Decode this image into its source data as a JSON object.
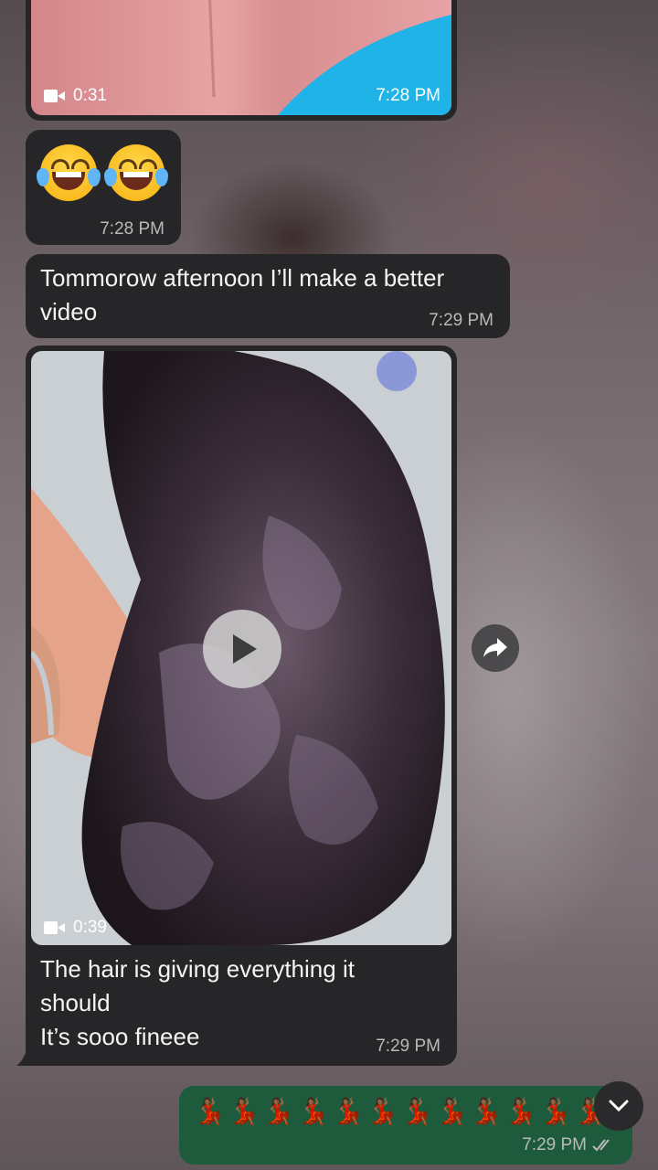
{
  "messages": {
    "video_top": {
      "duration": "0:31",
      "time": "7:28 PM"
    },
    "emoji_msg": {
      "emojis": "😂😂",
      "time": "7:28 PM"
    },
    "text_msg": {
      "text": "Tommorow afternoon I’ll make a better video",
      "time": "7:29 PM"
    },
    "video_main": {
      "duration": "0:39",
      "caption": "The hair is giving everything it should\nIt’s sooo fineee",
      "time": "7:29 PM"
    },
    "outgoing": {
      "text": "💃🏾💃🏾💃🏾💃🏾💃🏾💃🏾💃🏾💃🏾💃🏾💃🏾💃🏾💃🏾💃🏾",
      "time": "7:29 PM"
    }
  },
  "icons": {
    "video": "video-camera-icon",
    "play": "play-icon",
    "forward": "forward-arrow-icon",
    "scroll": "chevron-down-icon",
    "read": "double-check-icon"
  },
  "colors": {
    "incoming_bubble": "#262628",
    "outgoing_bubble": "#1e5b3d",
    "read_receipt": "#b9b9b9"
  }
}
